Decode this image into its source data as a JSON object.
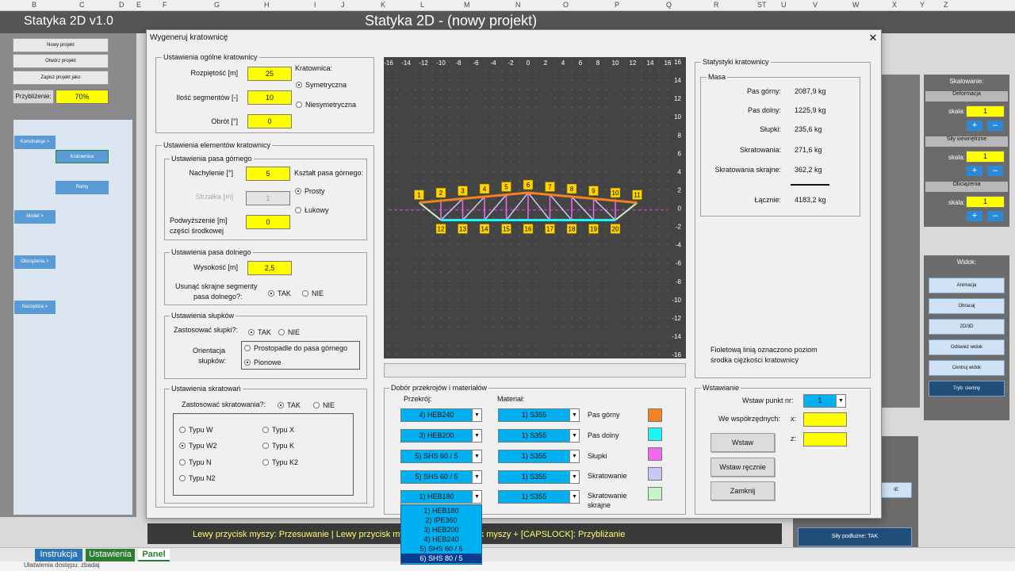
{
  "app": {
    "title": "Statyka 2D v1.0",
    "project_title": "Statyka 2D - (nowy projekt)",
    "columns": [
      "B",
      "C",
      "D",
      "E",
      "F",
      "G",
      "H",
      "I",
      "J",
      "K",
      "L",
      "M",
      "N",
      "O",
      "P",
      "Q",
      "R",
      "ST",
      "U",
      "V",
      "W",
      "X",
      "Y",
      "Z"
    ],
    "left": {
      "new": "Nowy projekt",
      "open": "Otwórz projekt",
      "save_as": "Zapisz projekt jako",
      "zoom_label": "Przybliżenie:",
      "zoom_value": "70%",
      "tree": {
        "konstrukcje": "Konstrukcje >",
        "kratownice": "Kratownice",
        "ramy": "Ramy",
        "model": "Model >",
        "obciazenia": "Obciążenia >",
        "narzedzia": "Narzędzia >"
      }
    },
    "right": {
      "scaling": {
        "title": "Skalowanie:",
        "deformation": "Deformacja",
        "internal_forces": "Siły wewnętrzne",
        "loads": "Obciążenia",
        "scale_label": "skala:",
        "scale_values": [
          "1",
          "1",
          "1"
        ],
        "plus": "+",
        "minus": "–"
      },
      "view": {
        "title": "Widok:",
        "buttons": [
          "Animacja",
          "Obracaj",
          "2D/3D",
          "Odśwież widok",
          "Centruj widok",
          "Tryb: ciemny"
        ]
      },
      "axial_forces": "Siły podłużne: TAK",
      "partial_ie": "IE"
    },
    "status_text": "Lewy przycisk myszy: Przesuwanie   |   Lewy przycisk myszy   ...   Lewy przycisk myszy + [CAPSLOCK]: Przybliżanie",
    "sheet_tabs": [
      "Instrukcja",
      "Ustawienia",
      "Panel"
    ],
    "footer": "Ułatwienia dostępu: zbadaj"
  },
  "dialog": {
    "title": "Wygeneruj kratownicę",
    "close": "✕",
    "general": {
      "frame_title": "Ustawienia ogólne kratownicy",
      "span_label": "Rozpiętość [m]",
      "span_value": "25",
      "segments_label": "Ilość segmentów [-]",
      "segments_value": "10",
      "rotation_label": "Obrót [°]",
      "rotation_value": "0",
      "type_label": "Kratownica:",
      "type_options": [
        "Symetryczna",
        "Niesymetryczna"
      ]
    },
    "elements": {
      "frame_title": "Ustawienia elementów kratownicy",
      "top_chord": {
        "frame_title": "Ustawienia pasa górnego",
        "slope_label": "Nachylenie [°]",
        "slope_value": "5",
        "shape_label": "Kształt pasa górnego:",
        "shape_options": [
          "Prosty",
          "Łukowy"
        ],
        "arrow_label": "Strzałka [m]",
        "arrow_value": "1",
        "raise_label_1": "Podwyższenie   [m]",
        "raise_label_2": "części środkowej",
        "raise_value": "0"
      },
      "bottom_chord": {
        "frame_title": "Ustawienia pasa dolnego",
        "height_label": "Wysokość [m]",
        "height_value": "2,5",
        "remove_label_1": "Usunąć skrajne segmenty",
        "remove_label_2": "pasa dolnego?:",
        "yes": "TAK",
        "no": "NIE"
      },
      "posts": {
        "frame_title": "Ustawienia słupków",
        "use_label": "Zastosować słupki?:",
        "yes": "TAK",
        "no": "NIE",
        "orient_label_1": "Orientacja",
        "orient_label_2": "słupków:",
        "orient_options": [
          "Prostopadle do pasa górnego",
          "Pionowe"
        ]
      },
      "bracing": {
        "frame_title": "Ustawienia skratowań",
        "use_label": "Zastosować skratowania?:",
        "yes": "TAK",
        "no": "NIE",
        "types_left": [
          "Typu W",
          "Typu W2",
          "Typu N",
          "Typu N2"
        ],
        "types_right": [
          "Typu X",
          "Typu K",
          "Typu K2"
        ]
      }
    },
    "sections": {
      "frame_title": "Dobór przekrojów i materiałów",
      "section_header": "Przekrój:",
      "material_header": "Materiał:",
      "rows": [
        {
          "section": "4) HEB240",
          "material": "1) S355",
          "label": "Pas górny",
          "color": "#f58220"
        },
        {
          "section": "3) HEB200",
          "material": "1) S355",
          "label": "Pas dolny",
          "color": "#1ef5f5"
        },
        {
          "section": "5) SHS 60 / 5",
          "material": "1) S355",
          "label": "Słupki",
          "color": "#f06af0"
        },
        {
          "section": "5) SHS 60 / 5",
          "material": "1) S355",
          "label": "Skratowanie",
          "color": "#c8c8f5"
        },
        {
          "section": "1) HEB180",
          "material": "1) S355",
          "label": "Skratowanie",
          "label2": "skrajne",
          "color": "#c8f5c8"
        }
      ],
      "dropdown": [
        "1) HEB180",
        "2) IPE360",
        "3) HEB200",
        "4) HEB240",
        "5) SHS 60 / 5",
        "6) SHS 80 / 5"
      ],
      "dropdown_selected": 5
    },
    "stats": {
      "frame_title": "Statystyki kratownicy",
      "mass_title": "Masa",
      "rows": [
        {
          "label": "Pas górny:",
          "value": "2087,9 kg"
        },
        {
          "label": "Pas dolny:",
          "value": "1225,9 kg"
        },
        {
          "label": "Słupki:",
          "value": "235,6 kg"
        },
        {
          "label": "Skratowania:",
          "value": "271,6 kg"
        },
        {
          "label": "Skratowania skrajne:",
          "value": "362,2 kg"
        }
      ],
      "total_label": "Łącznie:",
      "total_value": "4183,2 kg",
      "note_1": "Fioletową linią oznaczono poziom",
      "note_2": "środka ciężkości kratownicy"
    },
    "insert": {
      "frame_title": "Wstawianie",
      "point_label": "Wstaw punkt nr:",
      "point_value": "1",
      "coords_label": "We  współrzędnych:",
      "x_label": "x:",
      "z_label": "z:",
      "x_value": "",
      "z_value": "",
      "btn_insert": "Wstaw",
      "btn_insert_manual": "Wstaw ręcznie",
      "btn_close": "Zamknij"
    },
    "preview": {
      "x_ticks": [
        "-16",
        "-14",
        "-12",
        "-10",
        "-8",
        "-6",
        "-4",
        "-2",
        "0",
        "2",
        "4",
        "6",
        "8",
        "10",
        "12",
        "14",
        "16"
      ],
      "y_ticks": [
        "16",
        "14",
        "12",
        "10",
        "8",
        "6",
        "4",
        "2",
        "0",
        "-2",
        "-4",
        "-6",
        "-8",
        "-10",
        "-12",
        "-14",
        "-16"
      ],
      "x_range": [
        -16,
        16
      ],
      "y_range": [
        -16,
        16
      ],
      "top_nodes": [
        "1",
        "2",
        "3",
        "4",
        "5",
        "6",
        "7",
        "8",
        "9",
        "10",
        "11"
      ],
      "bottom_nodes": [
        "12",
        "13",
        "14",
        "15",
        "16",
        "17",
        "18",
        "19",
        "20"
      ]
    }
  }
}
